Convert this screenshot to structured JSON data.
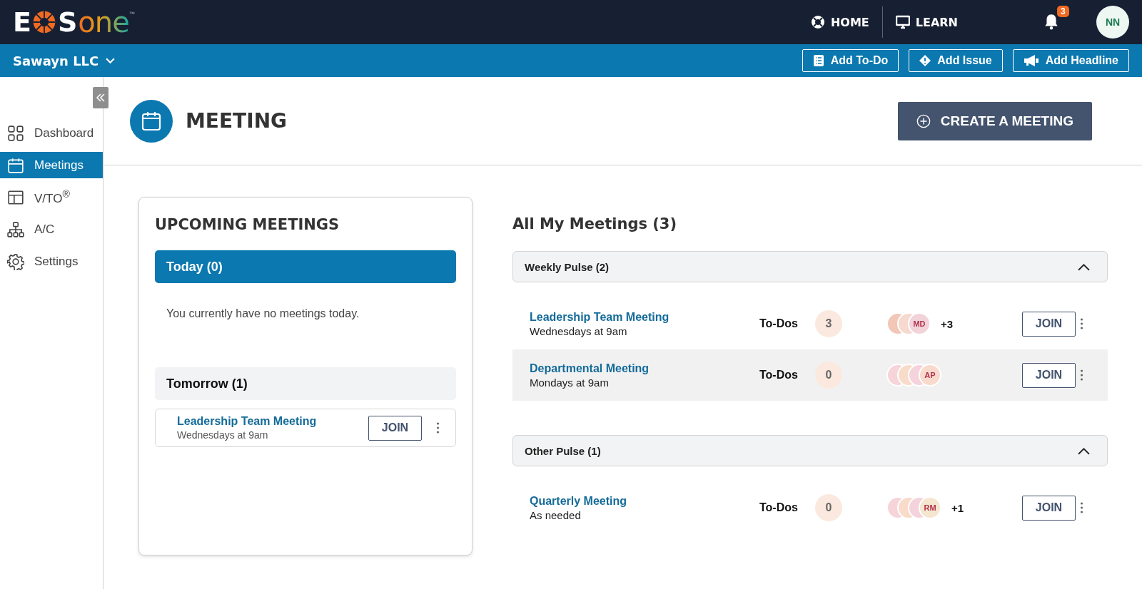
{
  "logo": {
    "first": "E",
    "middle": "S",
    "last": "one",
    "mark": "™"
  },
  "top_nav": [
    {
      "label": "HOME"
    },
    {
      "label": "LEARN"
    }
  ],
  "notifications": {
    "count": "3"
  },
  "user": {
    "initials": "NN"
  },
  "org": {
    "name": "Sawayn LLC"
  },
  "quick_actions": [
    {
      "label": "Add To-Do"
    },
    {
      "label": "Add Issue"
    },
    {
      "label": "Add Headline"
    }
  ],
  "sidebar": {
    "items": [
      {
        "label": "Dashboard",
        "selected": false
      },
      {
        "label": "Meetings",
        "selected": true
      },
      {
        "label": "V/TO$^{®}$",
        "selected": false
      },
      {
        "label": "A/C",
        "selected": false
      },
      {
        "label": "Settings",
        "selected": false
      }
    ]
  },
  "page": {
    "title": "MEETING",
    "create_button": "CREATE A MEETING"
  },
  "upcoming": {
    "title": "UPCOMING MEETINGS",
    "groups": [
      {
        "label": "Today (0)",
        "selected": true,
        "empty_text": "You currently have no meetings today."
      },
      {
        "label": "Tomorrow (1)",
        "selected": false,
        "meetings": [
          {
            "title": "Leadership Team Meeting",
            "schedule": "Wednesdays at 9am",
            "button": "JOIN"
          }
        ]
      }
    ]
  },
  "all_meetings": {
    "title": "All My Meetings (3)",
    "groups": [
      {
        "label": "Weekly Pulse (2)",
        "expanded": true,
        "meetings": [
          {
            "title": "Leadership Team Meeting",
            "schedule": "Wednesdays at 9am",
            "todos_label": "To-Dos",
            "todos": "3",
            "avatars": [
              {
                "color": "#f3c7b8"
              },
              {
                "color": "#f6d9cf"
              },
              {
                "color": "#f2d3da",
                "initials": "MD"
              }
            ],
            "more": "+3",
            "button": "JOIN",
            "selected": false
          },
          {
            "title": "Departmental Meeting",
            "schedule": "Mondays at 9am",
            "todos_label": "To-Dos",
            "todos": "0",
            "avatars": [
              {
                "color": "#f6d4da"
              },
              {
                "color": "#f8dcc9"
              },
              {
                "color": "#f4d3dc"
              },
              {
                "color": "#f9dacd",
                "initials": "AP"
              }
            ],
            "button": "JOIN",
            "selected": true
          }
        ]
      },
      {
        "label": "Other Pulse (1)",
        "expanded": true,
        "meetings": [
          {
            "title": "Quarterly Meeting",
            "schedule": "As needed",
            "todos_label": "To-Dos",
            "todos": "0",
            "avatars": [
              {
                "color": "#f6d4da"
              },
              {
                "color": "#f8dcc9"
              },
              {
                "color": "#f4d3dc"
              },
              {
                "color": "#f5e6cf",
                "initials": "RM"
              }
            ],
            "more": "+1",
            "button": "JOIN",
            "selected": false
          }
        ]
      }
    ]
  }
}
